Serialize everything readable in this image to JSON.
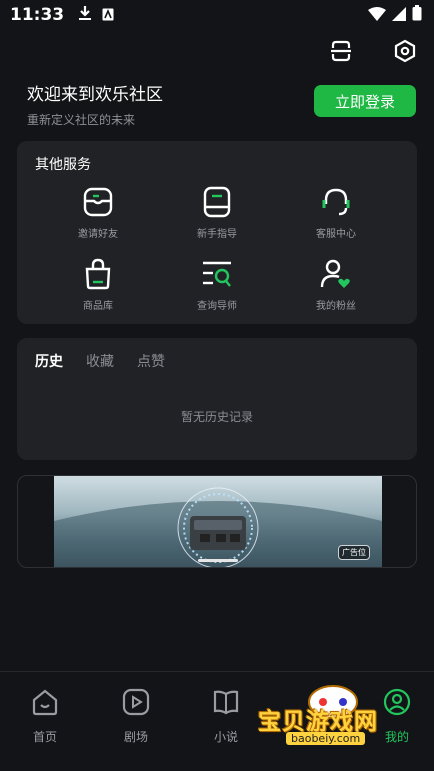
{
  "status_bar": {
    "time": "11:33"
  },
  "welcome": {
    "title": "欢迎来到欢乐社区",
    "subtitle": "重新定义社区的未来",
    "login_button": "立即登录"
  },
  "services": {
    "title": "其他服务",
    "items": [
      {
        "label": "邀请好友",
        "icon": "invite-icon"
      },
      {
        "label": "新手指导",
        "icon": "guide-icon"
      },
      {
        "label": "客服中心",
        "icon": "headset-icon"
      },
      {
        "label": "商品库",
        "icon": "shopping-bag-icon"
      },
      {
        "label": "查询导师",
        "icon": "search-list-icon"
      },
      {
        "label": "我的粉丝",
        "icon": "fans-icon"
      }
    ]
  },
  "history": {
    "tabs": [
      "历史",
      "收藏",
      "点赞"
    ],
    "active_tab": "历史",
    "empty_text": "暂无历史记录"
  },
  "banner": {
    "ad_label": "广告位"
  },
  "bottom_nav": {
    "items": [
      {
        "label": "首页",
        "icon": "home-icon"
      },
      {
        "label": "剧场",
        "icon": "play-icon"
      },
      {
        "label": "小说",
        "icon": "book-icon"
      },
      {
        "label": "我的",
        "icon": "profile-icon"
      }
    ],
    "active": "我的"
  },
  "watermark": {
    "text": "宝贝游戏网",
    "url": "baobeiy.com"
  },
  "colors": {
    "accent": "#1fb844",
    "background": "#131417",
    "card": "#212226"
  }
}
